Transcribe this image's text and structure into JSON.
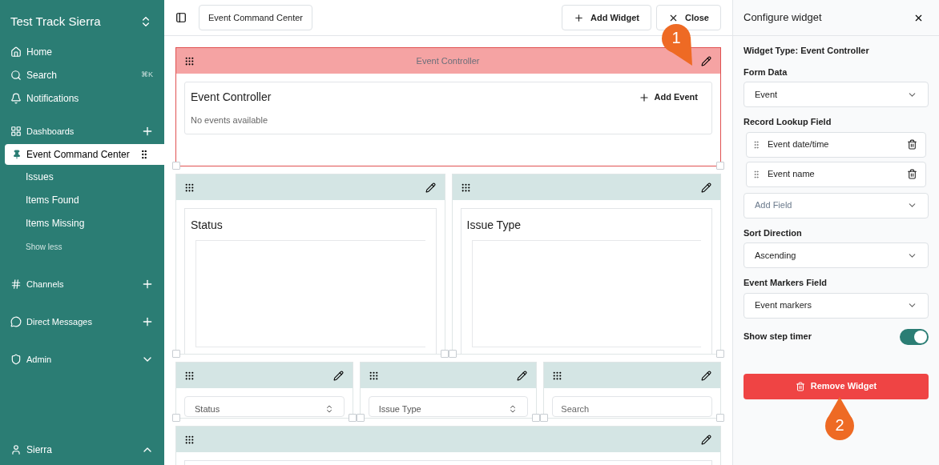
{
  "sidebar": {
    "workspace": "Test Track Sierra",
    "nav": [
      {
        "label": "Home"
      },
      {
        "label": "Search",
        "shortcut": "⌘K"
      },
      {
        "label": "Notifications"
      }
    ],
    "sections": [
      {
        "label": "Dashboards",
        "items": [
          {
            "label": "Event Command Center",
            "selected": true
          },
          {
            "label": "Issues",
            "selected": false
          },
          {
            "label": "Items Found",
            "selected": false
          },
          {
            "label": "Items Missing",
            "selected": false
          }
        ],
        "toggle": "Show less"
      },
      {
        "label": "Channels"
      },
      {
        "label": "Direct Messages"
      },
      {
        "label": "Admin"
      }
    ],
    "user": {
      "name": "Sierra"
    }
  },
  "toolbar": {
    "title": "Event Command Center",
    "buttons": [
      "Add Widget",
      "Close"
    ]
  },
  "widgets": [
    [
      {
        "kind": "controller",
        "selected": true,
        "header_title": "Event Controller",
        "title": "Event Controller",
        "action": "Add Event",
        "empty_text": "No events available"
      }
    ],
    [
      {
        "kind": "chart",
        "selected": false,
        "title": "Status"
      },
      {
        "kind": "chart",
        "selected": false,
        "title": "Issue Type"
      }
    ],
    [
      {
        "kind": "select",
        "selected": false,
        "value": "Status"
      },
      {
        "kind": "select",
        "selected": false,
        "value": "Issue Type"
      },
      {
        "kind": "search",
        "selected": false,
        "placeholder": "Search"
      }
    ],
    [
      {
        "kind": "blank",
        "selected": false
      }
    ]
  ],
  "panel": {
    "title": "Configure widget",
    "widget_type": "Widget Type: **Event Controller**",
    "form_data": {
      "label": "Form Data",
      "value": "Event"
    },
    "lookup": {
      "label": "Record Lookup Field",
      "items": [
        "Event date/time",
        "Event name"
      ],
      "placeholder": "Add Field"
    },
    "sort": {
      "label": "Sort Direction",
      "value": "Ascending"
    },
    "markers": {
      "label": "Event Markers Field",
      "value": "Event markers"
    },
    "toggle": {
      "label": "Show step timer",
      "on": true
    },
    "remove": "Remove Widget"
  },
  "callouts": [
    {
      "label": "1"
    },
    {
      "label": "2"
    }
  ]
}
